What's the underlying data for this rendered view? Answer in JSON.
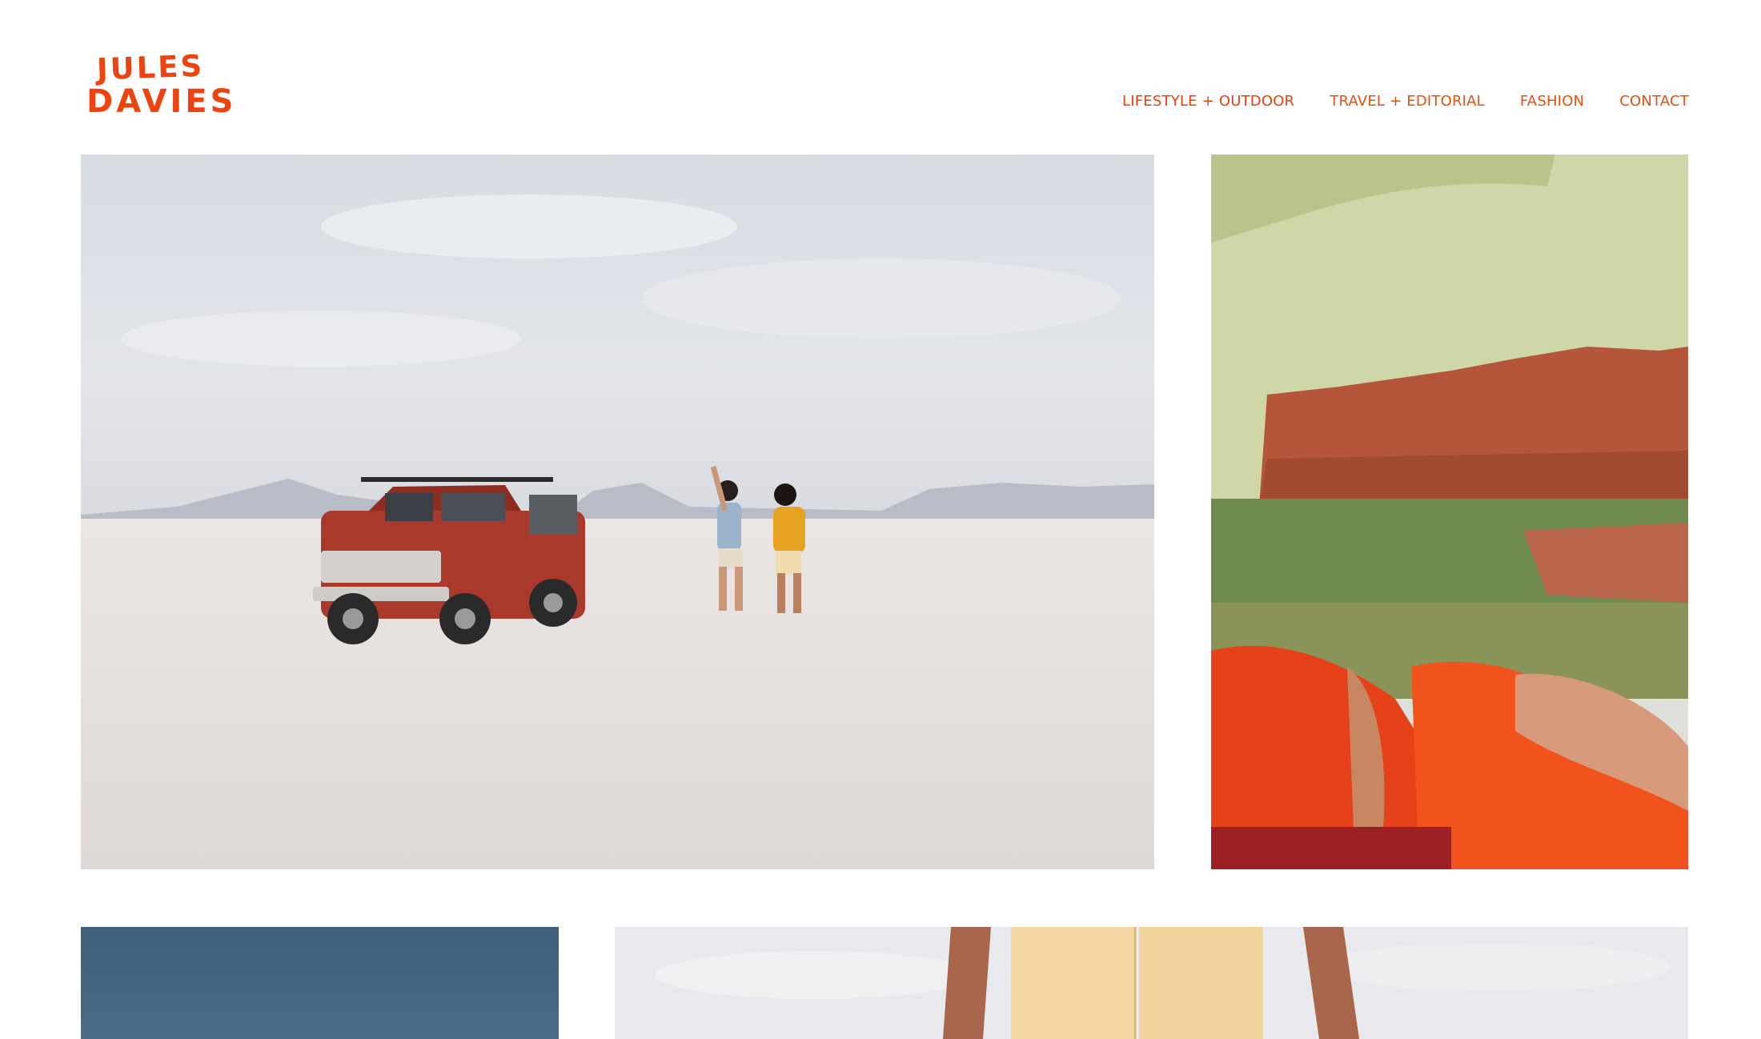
{
  "site": {
    "logo_line1": "JULES",
    "logo_line2": "DAVIES"
  },
  "nav": {
    "items": [
      {
        "label": "LIFESTYLE + OUTDOOR"
      },
      {
        "label": "TRAVEL + EDITORIAL"
      },
      {
        "label": "FASHION"
      },
      {
        "label": "CONTACT"
      }
    ]
  },
  "colors": {
    "brand": "#ec4410",
    "nav": "#e2500c",
    "background": "#ffffff"
  }
}
